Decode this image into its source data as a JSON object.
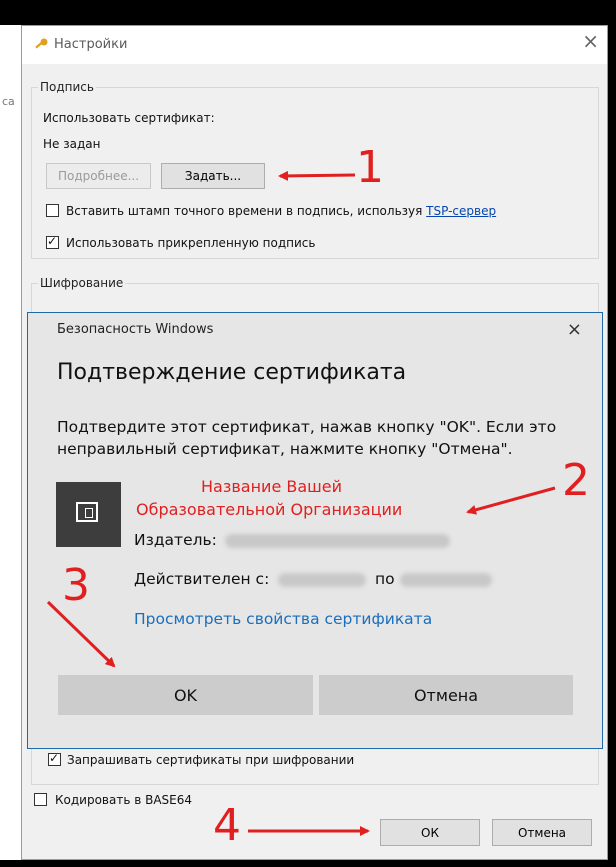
{
  "window": {
    "title": "Настройки",
    "close_glyph": "×"
  },
  "sign_group": {
    "label": "Подпись",
    "use_cert_label": "Использовать сертификат:",
    "cert_value": "Не задан",
    "details_button": "Подробнее...",
    "set_button": "Задать...",
    "timestamp_check": {
      "label": "Вставить штамп точного времени в подпись, используя",
      "link": "TSP-сервер",
      "checked": false
    },
    "attached_check": {
      "label": "Использовать прикрепленную подпись",
      "checked": true
    }
  },
  "encrypt_group": {
    "label": "Шифрование",
    "request_check": {
      "label": "Запрашивать сертификаты при шифровании",
      "checked": true
    }
  },
  "base64_check": {
    "label": "Кодировать в BASE64",
    "checked": false
  },
  "footer": {
    "ok": "ОК",
    "cancel": "Отмена"
  },
  "dialog": {
    "source": "Безопасность Windows",
    "close_glyph": "×",
    "heading": "Подтверждение сертификата",
    "message": "Подтвердите этот сертификат, нажав кнопку \"OK\". Если это неправильный сертификат, нажмите кнопку \"Отмена\".",
    "cert_name_line1": "Название Вашей",
    "cert_name_line2": "Образовательной Организации",
    "issuer_label": "Издатель:",
    "valid_from_label": "Действителен с:",
    "valid_to_label": "по",
    "view_props_link": "Просмотреть свойства сертификата",
    "ok": "OK",
    "cancel": "Отмена"
  },
  "annotations": {
    "n1": "1",
    "n2": "2",
    "n3": "3",
    "n4": "4",
    "color": "#e02020"
  }
}
